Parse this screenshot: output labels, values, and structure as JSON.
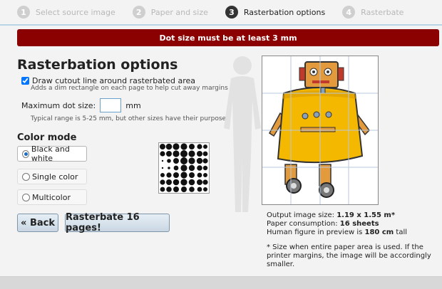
{
  "steps": [
    {
      "num": "1",
      "label": "Select source image"
    },
    {
      "num": "2",
      "label": "Paper and size"
    },
    {
      "num": "3",
      "label": "Rasterbation options"
    },
    {
      "num": "4",
      "label": "Rasterbate"
    }
  ],
  "alert": "Dot size must be at least 3 mm",
  "heading": "Rasterbation options",
  "cutout": {
    "label": "Draw cutout line around rasterbated area",
    "hint": "Adds a dim rectangle on each page to help cut away margins",
    "checked": true
  },
  "dot_size": {
    "label": "Maximum dot size:",
    "value": "",
    "unit": "mm",
    "hint": "Typical range is 5-25 mm, but other sizes have their purpose"
  },
  "color_mode": {
    "label": "Color mode",
    "options": [
      "Black and white",
      "Single color",
      "Multicolor"
    ],
    "selected": "Black and white"
  },
  "buttons": {
    "back": "« Back",
    "rasterbate": "Rasterbate 16 pages!"
  },
  "info": {
    "line1_label": "Output image size: ",
    "line1_value": "1.19 x 1.55 m*",
    "line2_label": "Paper consumption: ",
    "line2_value": "16 sheets",
    "line3_label": "Human figure in preview is ",
    "line3_value": "180 cm",
    "line3_suffix": " tall"
  },
  "note": "* Size when entire paper area is used. If the printer margins, the image will be accordingly smaller.",
  "colors": {
    "accent": "#8b0000",
    "robot": "#f5b800",
    "button": "#c9d7e3"
  }
}
